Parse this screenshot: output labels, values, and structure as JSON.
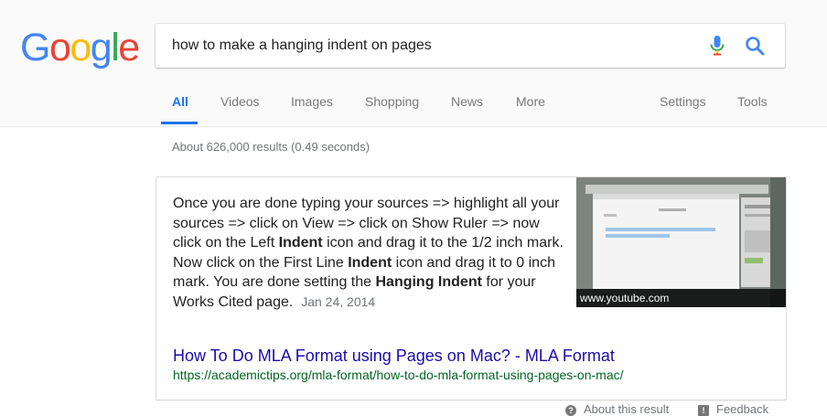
{
  "logo": {
    "letters": [
      "G",
      "o",
      "o",
      "g",
      "l",
      "e"
    ],
    "colors": [
      "#4285F4",
      "#EA4335",
      "#FBBC05",
      "#4285F4",
      "#34A853",
      "#EA4335"
    ]
  },
  "search": {
    "query": "how to make a hanging indent on pages",
    "mic_icon": "microphone-icon",
    "search_icon": "magnifier-icon"
  },
  "tabs": [
    {
      "label": "All",
      "active": true
    },
    {
      "label": "Videos"
    },
    {
      "label": "Images"
    },
    {
      "label": "Shopping"
    },
    {
      "label": "News"
    },
    {
      "label": "More"
    },
    {
      "label": "Settings"
    },
    {
      "label": "Tools"
    }
  ],
  "stats": "About 626,000 results (0.49 seconds)",
  "featured_snippet": {
    "text_parts": [
      {
        "t": "Once you are done typing your sources => highlight all your sources => click on View => click on Show Ruler => now click on the Left ",
        "b": false
      },
      {
        "t": "Indent",
        "b": true
      },
      {
        "t": " icon and drag it to the 1/2 inch mark. Now click on the First Line ",
        "b": false
      },
      {
        "t": "Indent",
        "b": true
      },
      {
        "t": " icon and drag it to 0 inch mark. You are done setting the ",
        "b": false
      },
      {
        "t": "Hanging Indent",
        "b": true
      },
      {
        "t": " for your Works Cited page.",
        "b": false
      }
    ],
    "date": "Jan 24, 2014",
    "thumbnail_caption": "www.youtube.com",
    "title": "How To Do MLA Format using Pages on Mac? - MLA Format",
    "url": "https://academictips.org/mla-format/how-to-do-mla-format-using-pages-on-mac/"
  },
  "footer": {
    "about": "About this result",
    "feedback": "Feedback"
  },
  "colors": {
    "accent": "#1a73e8",
    "link": "#1a0dab",
    "url_green": "#006621"
  }
}
